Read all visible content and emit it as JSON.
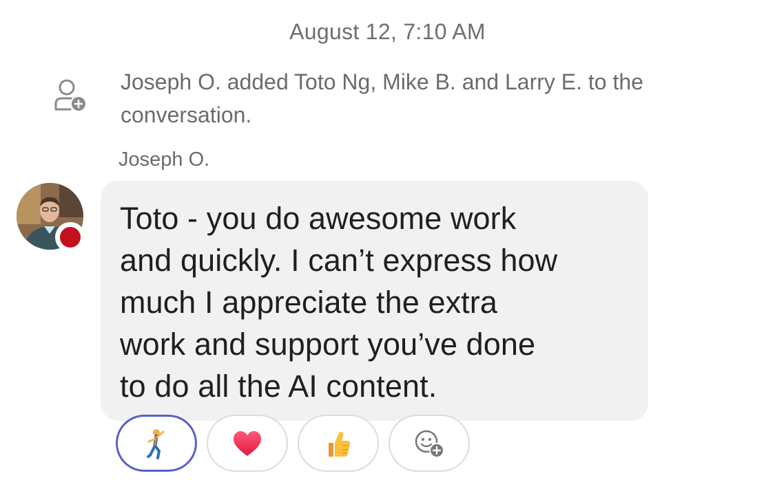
{
  "date_header": "August 12, 7:10 AM",
  "system_message": {
    "icon": "add-person-icon",
    "text": "Joseph O. added Toto Ng, Mike B. and Larry E. to the conversation."
  },
  "message": {
    "sender": "Joseph O.",
    "presence_color": "#c4101e",
    "text": "Toto - you do awesome work\nand quickly.  I can’t express how\nmuch I appreciate the extra\nwork and support you’ve done\nto do all the AI content."
  },
  "reactions": [
    {
      "icon": "dancing-person-icon",
      "emoji": "🕺",
      "selected": true
    },
    {
      "icon": "heart-icon",
      "emoji": "❤",
      "selected": false
    },
    {
      "icon": "thumbs-up-icon",
      "emoji": "👍",
      "selected": false
    },
    {
      "icon": "add-reaction-icon",
      "emoji": "",
      "selected": false
    }
  ],
  "colors": {
    "bubble_bg": "#f1f1f2",
    "selected_reaction_border": "#5b5fc7",
    "muted_text": "#6b6b6b"
  }
}
